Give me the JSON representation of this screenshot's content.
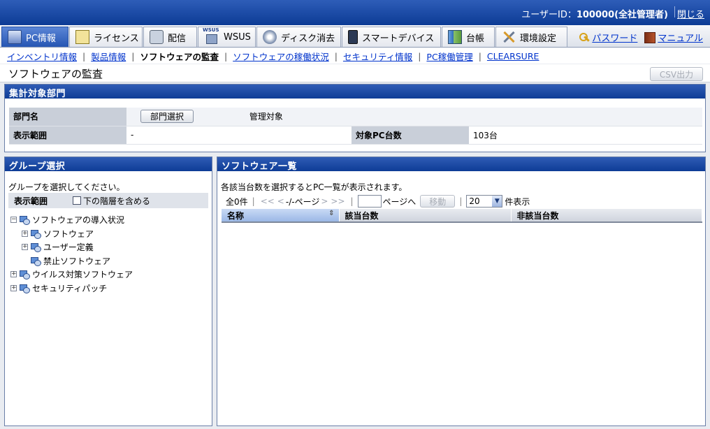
{
  "header": {
    "user_label": "ユーザーID：",
    "user_id": "100000(全社管理者)",
    "close_label": "閉じる"
  },
  "tabs": [
    {
      "label": "PC情報",
      "icon": "pc-icon",
      "active": true
    },
    {
      "label": "ライセンス",
      "icon": "license-icon"
    },
    {
      "label": "配信",
      "icon": "distribution-icon"
    },
    {
      "label": "WSUS",
      "icon": "wsus-icon"
    },
    {
      "label": "ディスク消去",
      "icon": "disk-erase-icon"
    },
    {
      "label": "スマートデバイス",
      "icon": "smart-device-icon"
    },
    {
      "label": "台帳",
      "icon": "ledger-icon"
    },
    {
      "label": "環境設定",
      "icon": "settings-tools-icon"
    }
  ],
  "right_links": {
    "password": "パスワード",
    "manual": "マニュアル"
  },
  "subnav": [
    {
      "label": "インベントリ情報",
      "link": true
    },
    {
      "label": "製品情報",
      "link": true
    },
    {
      "label": "ソフトウェアの監査",
      "link": false
    },
    {
      "label": "ソフトウェアの稼働状況",
      "link": true
    },
    {
      "label": "セキュリティ情報",
      "link": true
    },
    {
      "label": "PC稼働管理",
      "link": true
    },
    {
      "label": "CLEARSURE",
      "link": true
    }
  ],
  "page": {
    "title": "ソフトウェアの監査",
    "csv_button": "CSV出力"
  },
  "summary": {
    "title": "集計対象部門",
    "dept_label": "部門名",
    "dept_button": "部門選択",
    "dept_value": "管理対象",
    "range_label": "表示範囲",
    "range_value": "-",
    "pc_count_label": "対象PC台数",
    "pc_count_value": "103台"
  },
  "groups": {
    "title": "グループ選択",
    "hint": "グループを選択してください。",
    "range_label": "表示範囲",
    "include_sub_label": "下の階層を含める",
    "tree": [
      {
        "label": "ソフトウェアの導入状況",
        "level": 0,
        "expander": "⊟"
      },
      {
        "label": "ソフトウェア",
        "level": 1,
        "expander": "+"
      },
      {
        "label": "ユーザー定義",
        "level": 1,
        "expander": "+"
      },
      {
        "label": "禁止ソフトウェア",
        "level": 1,
        "expander": ""
      },
      {
        "label": "ウイルス対策ソフトウェア",
        "level": 0,
        "expander": "+"
      },
      {
        "label": "セキュリティパッチ",
        "level": 0,
        "expander": "+"
      }
    ]
  },
  "software": {
    "title": "ソフトウェア一覧",
    "hint": "各該当台数を選択するとPC一覧が表示されます。",
    "total": "全0件",
    "first": "<<",
    "prev": "<",
    "page_text": "-/-ページ",
    "next": ">",
    "last": ">>",
    "page_to": "ページへ",
    "move_button": "移動",
    "per_page": "20",
    "per_page_suffix": "件表示",
    "columns": [
      "名称",
      "該当台数",
      "非該当台数"
    ]
  }
}
